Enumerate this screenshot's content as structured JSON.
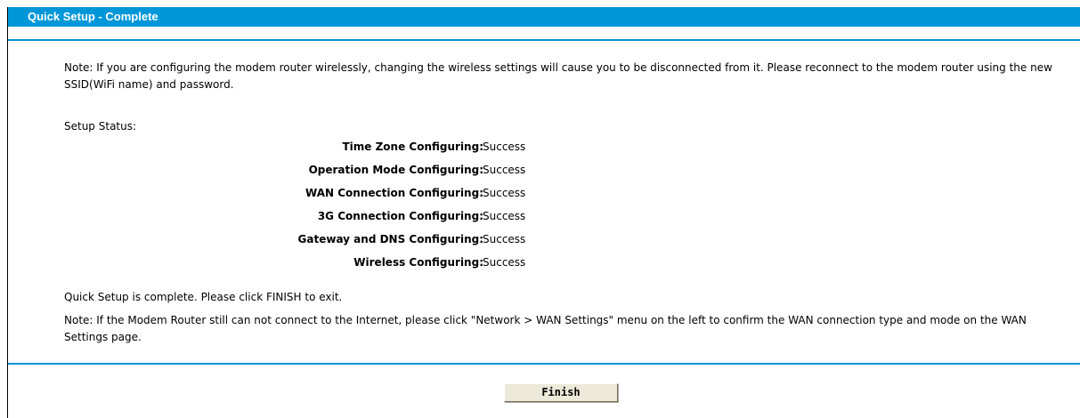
{
  "header": {
    "title": "Quick Setup - Complete"
  },
  "notes": {
    "wireless_note": "Note: If you are configuring the modem router wirelessly, changing the wireless settings will cause you to be disconnected from it. Please reconnect to the modem router using the new SSID(WiFi name) and password.",
    "setup_status_label": "Setup Status:",
    "complete_message": "Quick Setup is complete. Please click FINISH to exit.",
    "wan_note": "Note: If the Modem Router still can not connect to the Internet, please click \"Network > WAN Settings\" menu on the left to confirm the WAN connection type and mode on the WAN Settings page."
  },
  "status_rows": [
    {
      "label": "Time Zone Configuring:",
      "value": "Success"
    },
    {
      "label": "Operation Mode Configuring:",
      "value": "Success"
    },
    {
      "label": "WAN Connection Configuring:",
      "value": "Success"
    },
    {
      "label": "3G Connection Configuring:",
      "value": "Success"
    },
    {
      "label": "Gateway and DNS Configuring:",
      "value": "Success"
    },
    {
      "label": "Wireless Configuring:",
      "value": "Success"
    }
  ],
  "actions": {
    "finish_label": "Finish"
  },
  "colors": {
    "accent": "#0097d9",
    "button_face": "#ece9d8"
  }
}
